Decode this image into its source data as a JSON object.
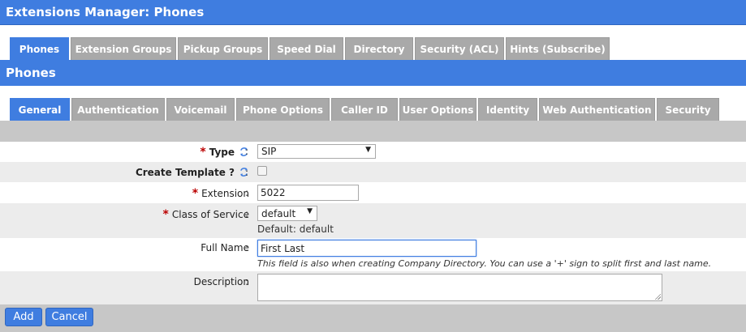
{
  "window": {
    "title": "Extensions Manager:  Phones"
  },
  "main_tabs": [
    {
      "label": "Phones",
      "active": true
    },
    {
      "label": "Extension Groups",
      "active": false
    },
    {
      "label": "Pickup Groups",
      "active": false
    },
    {
      "label": "Speed Dial",
      "active": false
    },
    {
      "label": "Directory",
      "active": false
    },
    {
      "label": "Security (ACL)",
      "active": false
    },
    {
      "label": "Hints (Subscribe)",
      "active": false
    }
  ],
  "section": {
    "title": "Phones"
  },
  "sub_tabs": [
    {
      "label": "General",
      "active": true
    },
    {
      "label": "Authentication",
      "active": false
    },
    {
      "label": "Voicemail",
      "active": false
    },
    {
      "label": "Phone Options",
      "active": false
    },
    {
      "label": "Caller ID",
      "active": false
    },
    {
      "label": "User Options",
      "active": false
    },
    {
      "label": "Identity",
      "active": false
    },
    {
      "label": "Web Authentication",
      "active": false
    },
    {
      "label": "Security",
      "active": false
    }
  ],
  "form": {
    "colon": ":",
    "required_mark": "*",
    "type": {
      "label": "Type",
      "value": "SIP"
    },
    "create_template": {
      "label": "Create Template ?",
      "checked": false
    },
    "extension": {
      "label": "Extension",
      "value": "5022"
    },
    "class_of_service": {
      "label": "Class of Service",
      "value": "default",
      "default_text": "Default: default"
    },
    "full_name": {
      "label": "Full Name",
      "value": "First Last",
      "hint": "This field is also when creating Company Directory. You can use a '+' sign to split first and last name."
    },
    "description": {
      "label": "Description",
      "value": ""
    }
  },
  "buttons": {
    "add": "Add",
    "cancel": "Cancel"
  },
  "colors": {
    "accent": "#3f7de0",
    "tab_inactive": "#a9a9a9",
    "required": "#bb0000"
  }
}
